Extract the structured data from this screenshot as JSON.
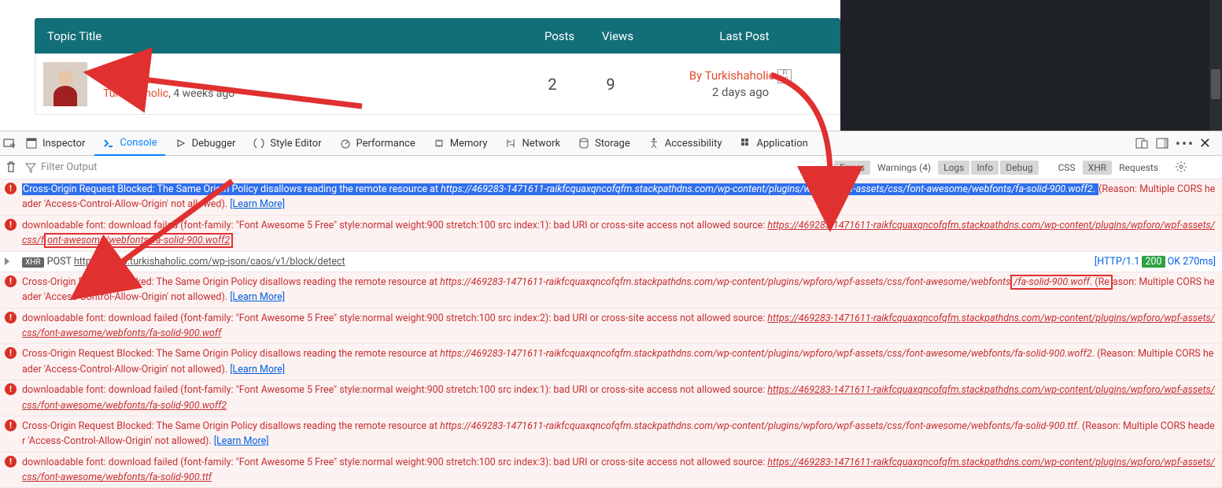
{
  "forum": {
    "header": {
      "title": "Topic Title",
      "posts": "Posts",
      "views": "Views",
      "last": "Last Post"
    },
    "row": {
      "badge": "FI SC",
      "topic_char": "T",
      "author": "Turkishaholic",
      "sep": ", ",
      "age": "4 weeks ago",
      "posts": "2",
      "views": "9",
      "by_prefix": "By ",
      "last_author": "Turkishaholic",
      "last_badge": "FI SC",
      "last_when": "2 days ago"
    }
  },
  "devtools_tabs": {
    "inspector": "Inspector",
    "console": "Console",
    "debugger": "Debugger",
    "style": "Style Editor",
    "performance": "Performance",
    "memory": "Memory",
    "network": "Network",
    "storage": "Storage",
    "accessibility": "Accessibility",
    "application": "Application"
  },
  "filter": {
    "placeholder": "Filter Output"
  },
  "chips": {
    "errors": "Errors",
    "warnings": "Warnings (4)",
    "logs": "Logs",
    "info": "Info",
    "debug": "Debug",
    "css": "CSS",
    "xhr": "XHR",
    "requests": "Requests"
  },
  "msgs": {
    "m1a": "Cross-Origin Request Blocked: The Same Origin Policy disallows reading the remote resource at ",
    "m1b": "https://469283-1471611-raikfcquaxqncofqfm.stackpathdns.com/wp-content/plugins/wpforo/wpf-assets/css/font-awesome/webfonts/fa-solid-900.woff2",
    "m1c": ". ",
    "m1d": "(Reason: Multiple CORS header 'Access-Control-Allow-Origin' not allowed). ",
    "learn": "[Learn More]",
    "m2a": "downloadable font: download failed (font-family: \"Font Awesome 5 Free\" style:normal weight:900 stretch:100 src index:1): bad URI or cross-site access not allowed source: ",
    "m2b_pre": "https://469283-1471611-raikfcquaxqncofqfm.stackpathdns.com/wp-content/plugins/wpforo/wpf-assets/css/f",
    "m2b_box": "ont-awesome/webfonts/fa-solid-900.woff2",
    "xhr_tag": "XHR",
    "m3a": "POST ",
    "m3b": "https://www.turkishaholic.com/wp-json/caos/v1/block/detect",
    "m3_meta_a": "[HTTP/1.1 ",
    "m3_meta_b": "200",
    "m3_meta_c": " OK 270ms]",
    "m4a": "Cross-Origin Request Blocked: The Same Origin Policy disallows reading the remote resource at ",
    "m4b": "https://469283-1471611-raikfcquaxqncofqfm.stackpathdns.com/wp-content/plugins/wpforo/wpf-assets/css/font-awesome/webfonts",
    "m4box": "/fa-solid-900.woff",
    "m4c": ". (Re",
    "m4d": "ason: Multiple CORS header 'Access-Control-Allow-Origin' not allowed). ",
    "m5a": "downloadable font: download failed (font-family: \"Font Awesome 5 Free\" style:normal weight:900 stretch:100 src index:2): bad URI or cross-site access not allowed source: ",
    "m5b": "https://469283-1471611-raikfcquaxqncofqfm.stackpathdns.com/wp-content/plugins/wpforo/wpf-assets/css/font-awesome/webfonts/fa-solid-900.woff",
    "m6a": "Cross-Origin Request Blocked: The Same Origin Policy disallows reading the remote resource at ",
    "m6b": "https://469283-1471611-raikfcquaxqncofqfm.stackpathdns.com/wp-content/plugins/wpforo/wpf-assets/css/font-awesome/webfonts/fa-solid-900.woff2",
    "m6c": ". (Reason: Multiple CORS header 'Access-Control-Allow-Origin' not allowed). ",
    "m7a": "downloadable font: download failed (font-family: \"Font Awesome 5 Free\" style:normal weight:900 stretch:100 src index:1): bad URI or cross-site access not allowed source: ",
    "m7b": "https://469283-1471611-raikfcquaxqncofqfm.stackpathdns.com/wp-content/plugins/wpforo/wpf-assets/css/font-awesome/webfonts/fa-solid-900.woff2",
    "m8a": "Cross-Origin Request Blocked: The Same Origin Policy disallows reading the remote resource at ",
    "m8b": "https://469283-1471611-raikfcquaxqncofqfm.stackpathdns.com/wp-content/plugins/wpforo/wpf-assets/css/font-awesome/webfonts/fa-solid-900.ttf",
    "m8c": ". (Reason: Multiple CORS header 'Access-Control-Allow-Origin' not allowed). ",
    "m9a": "downloadable font: download failed (font-family: \"Font Awesome 5 Free\" style:normal weight:900 stretch:100 src index:3): bad URI or cross-site access not allowed source: ",
    "m9b": "https://469283-1471611-raikfcquaxqncofqfm.stackpathdns.com/wp-content/plugins/wpforo/wpf-assets/css/font-awesome/webfonts/fa-solid-900.ttf"
  }
}
